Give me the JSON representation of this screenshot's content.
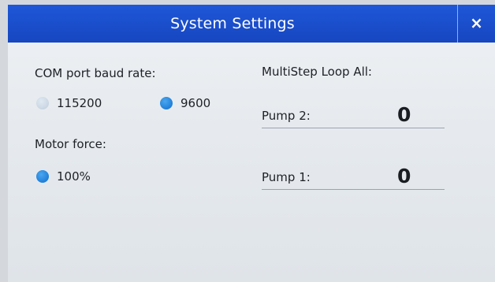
{
  "window": {
    "title": "System Settings",
    "close_glyph": "×"
  },
  "left_panel": {
    "baud_label": "COM port baud rate:",
    "baud_options": [
      {
        "label": "115200",
        "selected": false
      },
      {
        "label": "9600",
        "selected": true
      }
    ],
    "motor_label": "Motor force:",
    "motor_options": [
      {
        "label": "100%",
        "selected": true
      }
    ]
  },
  "right_panel": {
    "loop_label": "MultiStep Loop All:",
    "pumps": [
      {
        "label": "Pump 2:",
        "value": "0"
      },
      {
        "label": "Pump 1:",
        "value": "0"
      }
    ]
  },
  "colors": {
    "titlebar": "#1d52d4",
    "radio_selected": "#1f7fd8",
    "radio_unselected": "#c6d3e0"
  },
  "icons": {
    "close": "close-icon",
    "radio_on": "radio-selected-icon",
    "radio_off": "radio-unselected-icon"
  }
}
